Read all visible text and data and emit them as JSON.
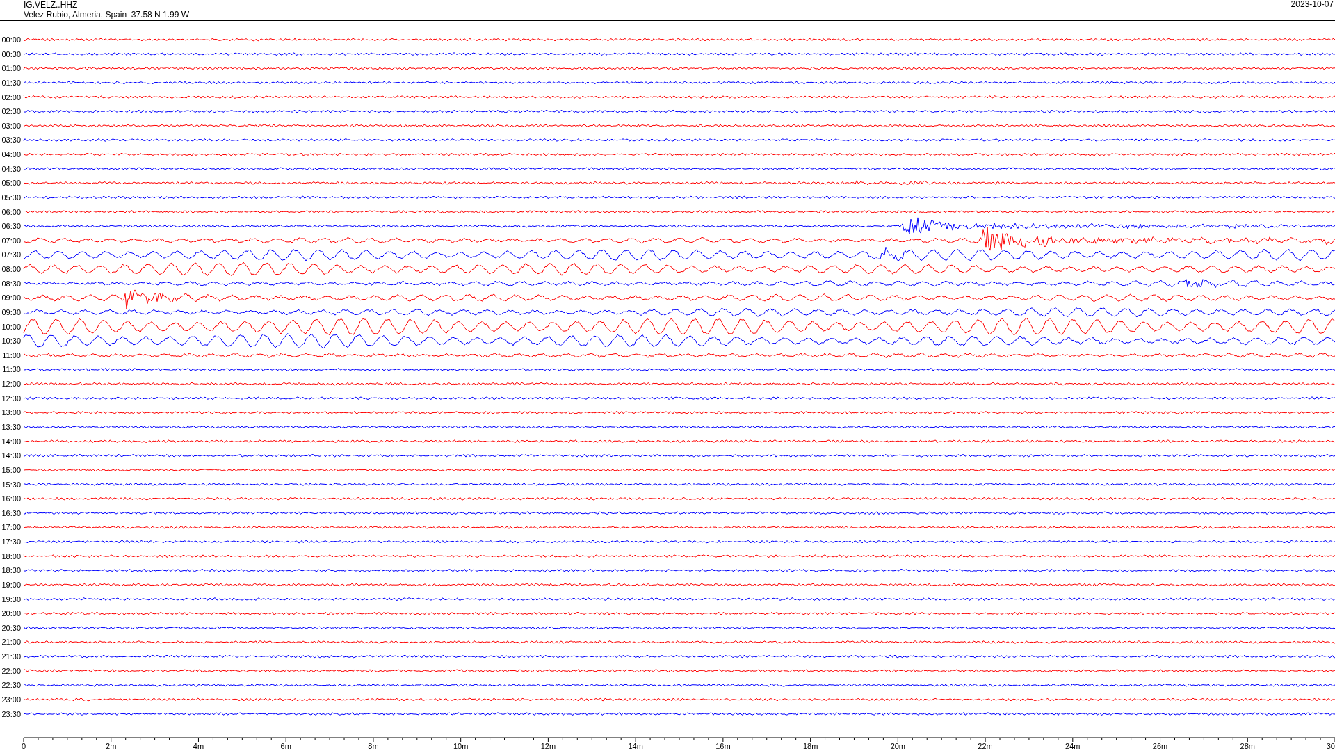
{
  "header": {
    "station": "IG.VELZ..HHZ",
    "location": "Velez Rubio, Almeria, Spain  37.58 N 1.99 W",
    "date": "2023-10-07"
  },
  "rows": [
    {
      "time": "00:00",
      "color": "#ff0000"
    },
    {
      "time": "00:30",
      "color": "#0000ff"
    },
    {
      "time": "01:00",
      "color": "#ff0000"
    },
    {
      "time": "01:30",
      "color": "#0000ff"
    },
    {
      "time": "02:00",
      "color": "#ff0000"
    },
    {
      "time": "02:30",
      "color": "#0000ff"
    },
    {
      "time": "03:00",
      "color": "#ff0000"
    },
    {
      "time": "03:30",
      "color": "#0000ff"
    },
    {
      "time": "04:00",
      "color": "#ff0000"
    },
    {
      "time": "04:30",
      "color": "#0000ff"
    },
    {
      "time": "05:00",
      "color": "#ff0000"
    },
    {
      "time": "05:30",
      "color": "#0000ff"
    },
    {
      "time": "06:00",
      "color": "#ff0000"
    },
    {
      "time": "06:30",
      "color": "#0000ff"
    },
    {
      "time": "07:00",
      "color": "#ff0000"
    },
    {
      "time": "07:30",
      "color": "#0000ff"
    },
    {
      "time": "08:00",
      "color": "#ff0000"
    },
    {
      "time": "08:30",
      "color": "#0000ff"
    },
    {
      "time": "09:00",
      "color": "#ff0000"
    },
    {
      "time": "09:30",
      "color": "#0000ff"
    },
    {
      "time": "10:00",
      "color": "#ff0000"
    },
    {
      "time": "10:30",
      "color": "#0000ff"
    },
    {
      "time": "11:00",
      "color": "#ff0000"
    },
    {
      "time": "11:30",
      "color": "#0000ff"
    },
    {
      "time": "12:00",
      "color": "#ff0000"
    },
    {
      "time": "12:30",
      "color": "#0000ff"
    },
    {
      "time": "13:00",
      "color": "#ff0000"
    },
    {
      "time": "13:30",
      "color": "#0000ff"
    },
    {
      "time": "14:00",
      "color": "#ff0000"
    },
    {
      "time": "14:30",
      "color": "#0000ff"
    },
    {
      "time": "15:00",
      "color": "#ff0000"
    },
    {
      "time": "15:30",
      "color": "#0000ff"
    },
    {
      "time": "16:00",
      "color": "#ff0000"
    },
    {
      "time": "16:30",
      "color": "#0000ff"
    },
    {
      "time": "17:00",
      "color": "#ff0000"
    },
    {
      "time": "17:30",
      "color": "#0000ff"
    },
    {
      "time": "18:00",
      "color": "#ff0000"
    },
    {
      "time": "18:30",
      "color": "#0000ff"
    },
    {
      "time": "19:00",
      "color": "#ff0000"
    },
    {
      "time": "19:30",
      "color": "#0000ff"
    },
    {
      "time": "20:00",
      "color": "#ff0000"
    },
    {
      "time": "20:30",
      "color": "#0000ff"
    },
    {
      "time": "21:00",
      "color": "#ff0000"
    },
    {
      "time": "21:30",
      "color": "#0000ff"
    },
    {
      "time": "22:00",
      "color": "#ff0000"
    },
    {
      "time": "22:30",
      "color": "#0000ff"
    },
    {
      "time": "23:00",
      "color": "#ff0000"
    },
    {
      "time": "23:30",
      "color": "#0000ff"
    }
  ],
  "x_axis": {
    "ticks": [
      "0",
      "2m",
      "4m",
      "6m",
      "8m",
      "10m",
      "12m",
      "14m",
      "16m",
      "18m",
      "20m",
      "22m",
      "24m",
      "26m",
      "28m",
      "30"
    ]
  }
}
